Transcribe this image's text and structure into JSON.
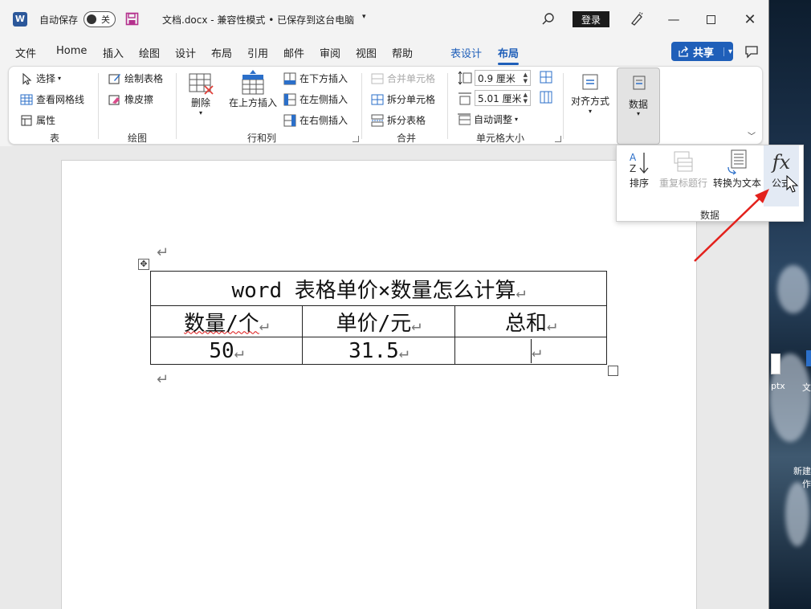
{
  "titlebar": {
    "autosave_label": "自动保存",
    "autosave_state": "关",
    "doc_title": "文档.docx  -  兼容性模式 • 已保存到这台电脑",
    "login": "登录"
  },
  "tabs": [
    {
      "label": "文件"
    },
    {
      "label": "Home"
    },
    {
      "label": "插入"
    },
    {
      "label": "绘图"
    },
    {
      "label": "设计"
    },
    {
      "label": "布局"
    },
    {
      "label": "引用"
    },
    {
      "label": "邮件"
    },
    {
      "label": "审阅"
    },
    {
      "label": "视图"
    },
    {
      "label": "帮助"
    },
    {
      "label": "表设计"
    },
    {
      "label": "布局"
    }
  ],
  "share_label": "共享",
  "ribbon": {
    "table_group": {
      "select": "选择",
      "gridlines": "查看网格线",
      "properties": "属性",
      "label": "表"
    },
    "draw_group": {
      "draw_table": "绘制表格",
      "eraser": "橡皮擦",
      "label": "绘图"
    },
    "rows_cols_group": {
      "delete": "删除",
      "insert_above": "在上方插入",
      "insert_below": "在下方插入",
      "insert_left": "在左侧插入",
      "insert_right": "在右侧插入",
      "label": "行和列"
    },
    "merge_group": {
      "merge_cells": "合并单元格",
      "split_cells": "拆分单元格",
      "split_table": "拆分表格",
      "label": "合并"
    },
    "cell_size_group": {
      "height": "0.9 厘米",
      "width": "5.01 厘米",
      "autofit": "自动调整",
      "label": "单元格大小"
    },
    "align_label": "对齐方式",
    "data_label": "数据"
  },
  "data_dropdown": {
    "sort": "排序",
    "repeat_header": "重复标题行",
    "convert_text": "转换为文本",
    "formula": "公式",
    "group_label": "数据"
  },
  "document": {
    "table": {
      "title": "word 表格单价×数量怎么计算",
      "headers": [
        "数量/个",
        "单价/元",
        "总和"
      ],
      "row": [
        "50",
        "31.5",
        ""
      ]
    }
  },
  "desktop": {
    "label1": "ptx",
    "label2": "文",
    "label3": "新建",
    "label4": "作"
  }
}
